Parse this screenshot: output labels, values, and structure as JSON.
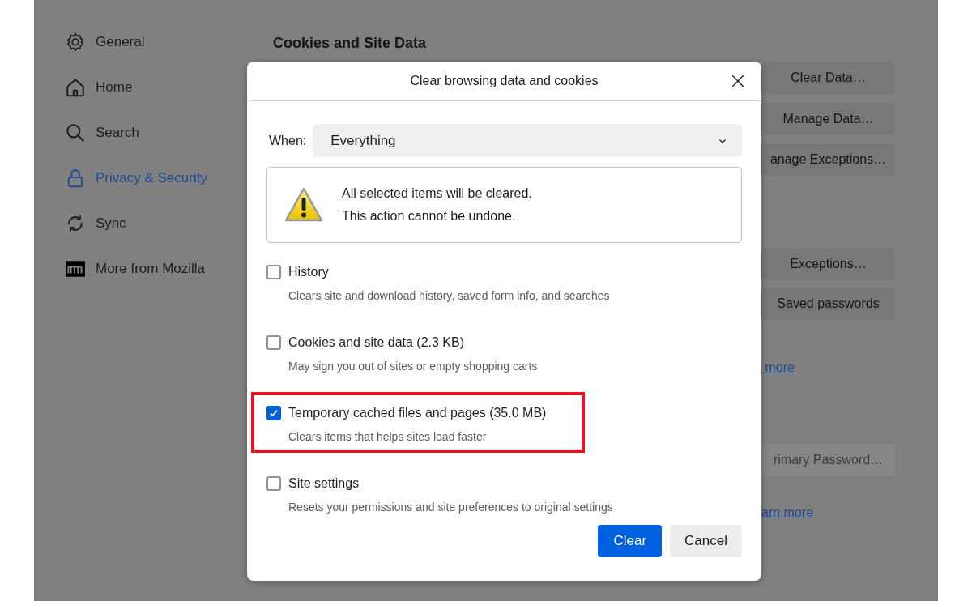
{
  "sidebar": {
    "items": [
      {
        "label": "General",
        "selected": false
      },
      {
        "label": "Home",
        "selected": false
      },
      {
        "label": "Search",
        "selected": false
      },
      {
        "label": "Privacy & Security",
        "selected": true
      },
      {
        "label": "Sync",
        "selected": false
      },
      {
        "label": "More from Mozilla",
        "selected": false
      }
    ]
  },
  "section": {
    "heading": "Cookies and Site Data",
    "controls": [
      {
        "kind": "button",
        "label": "Clear Data…",
        "disabled": false
      },
      {
        "kind": "button",
        "label": "Manage Data…",
        "disabled": false
      },
      {
        "kind": "button",
        "label": "anage Exceptions…",
        "disabled": false
      },
      {
        "kind": "button",
        "label": "Exceptions…",
        "disabled": false
      },
      {
        "kind": "button",
        "label": "Saved passwords",
        "disabled": false
      },
      {
        "kind": "link",
        "label": " more"
      },
      {
        "kind": "button",
        "label": "rimary Password…",
        "disabled": true
      },
      {
        "kind": "link",
        "label": "arn more"
      }
    ]
  },
  "dialog": {
    "title": "Clear browsing data and cookies",
    "close": "×",
    "when_label": "When:",
    "when_value": "Everything",
    "warning": [
      "All selected items will be cleared.",
      "This action cannot be undone."
    ],
    "items": [
      {
        "label": "History",
        "description": "Clears site and download history, saved form info, and searches",
        "checked": false,
        "highlighted": false
      },
      {
        "label": "Cookies and site data (2.3 KB)",
        "description": "May sign you out of sites or empty shopping carts",
        "checked": false,
        "highlighted": false
      },
      {
        "label": "Temporary cached files and pages (35.0 MB)",
        "description": "Clears items that helps sites load faster",
        "checked": true,
        "highlighted": true
      },
      {
        "label": "Site settings",
        "description": "Resets your permissions and site preferences to original settings",
        "checked": false,
        "highlighted": false
      }
    ],
    "buttons": [
      {
        "label": "Clear",
        "kind": "primary"
      },
      {
        "label": "Cancel",
        "kind": "secondary"
      }
    ]
  }
}
